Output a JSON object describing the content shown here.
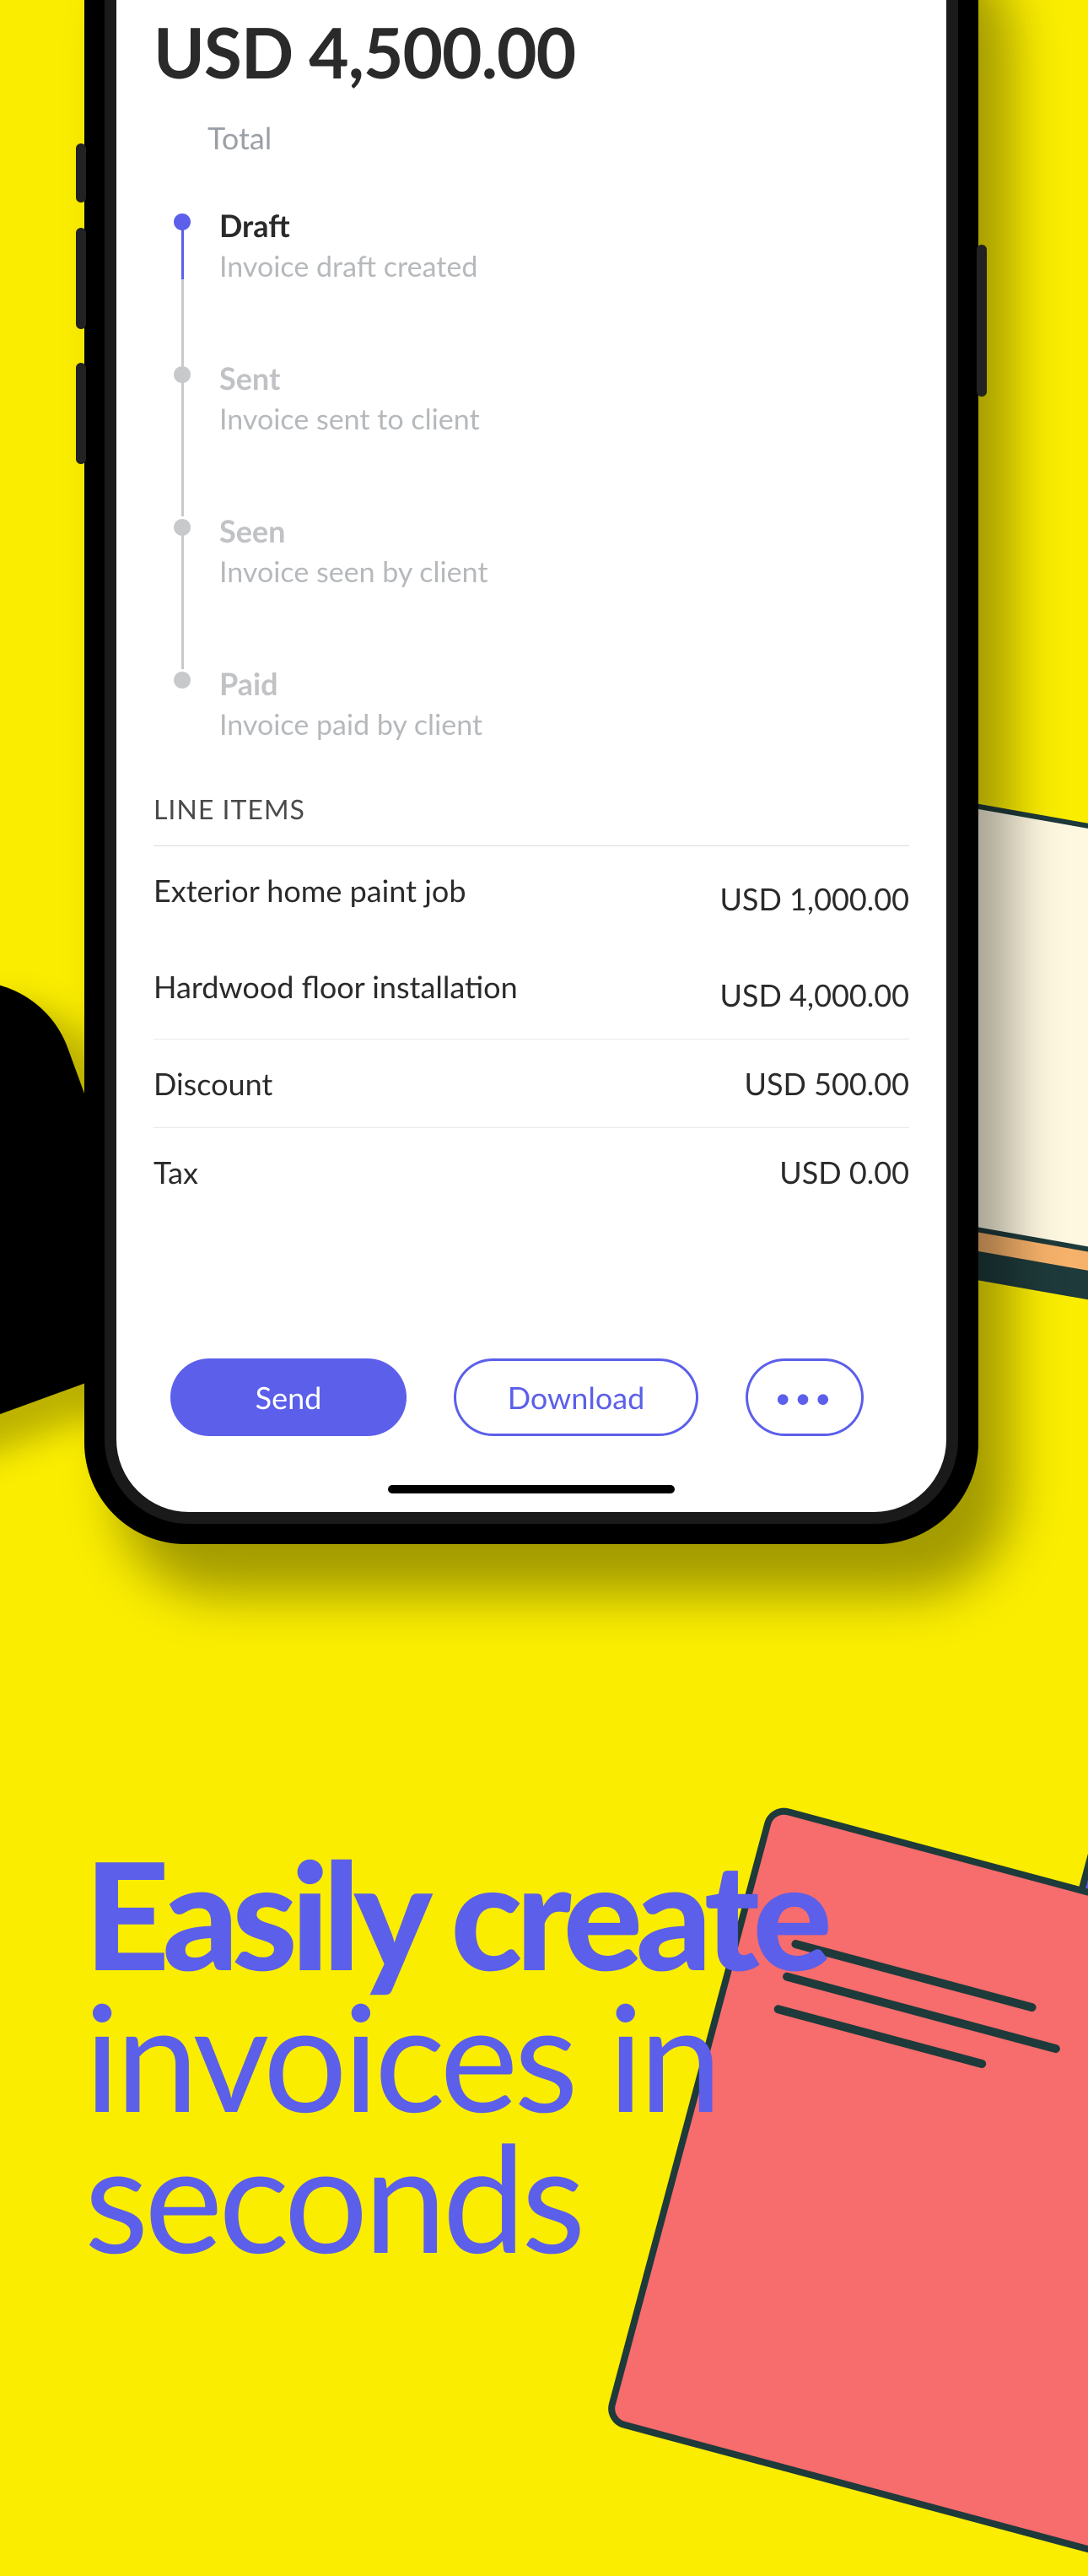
{
  "invoice": {
    "amount_display": "USD 4,500.00",
    "total_label": "Total"
  },
  "timeline": [
    {
      "title": "Draft",
      "subtitle": "Invoice draft created",
      "active": true
    },
    {
      "title": "Sent",
      "subtitle": "Invoice sent to client",
      "active": false
    },
    {
      "title": "Seen",
      "subtitle": "Invoice seen by client",
      "active": false
    },
    {
      "title": "Paid",
      "subtitle": "Invoice paid by client",
      "active": false
    }
  ],
  "line_items_header": "LINE ITEMS",
  "line_items": [
    {
      "name": "Exterior home paint job",
      "amount": "USD 1,000.00"
    },
    {
      "name": "Hardwood floor installation",
      "amount": "USD 4,000.00"
    }
  ],
  "totals": [
    {
      "name": "Discount",
      "amount": "USD 500.00"
    },
    {
      "name": "Tax",
      "amount": "USD 0.00"
    }
  ],
  "actions": {
    "send": "Send",
    "download": "Download",
    "more_glyph": "•••"
  },
  "marketing": {
    "bold": "Easily create",
    "line2": "invoices in",
    "line3": "seconds"
  },
  "colors": {
    "accent": "#5b5fe9",
    "bg": "#faed00"
  }
}
